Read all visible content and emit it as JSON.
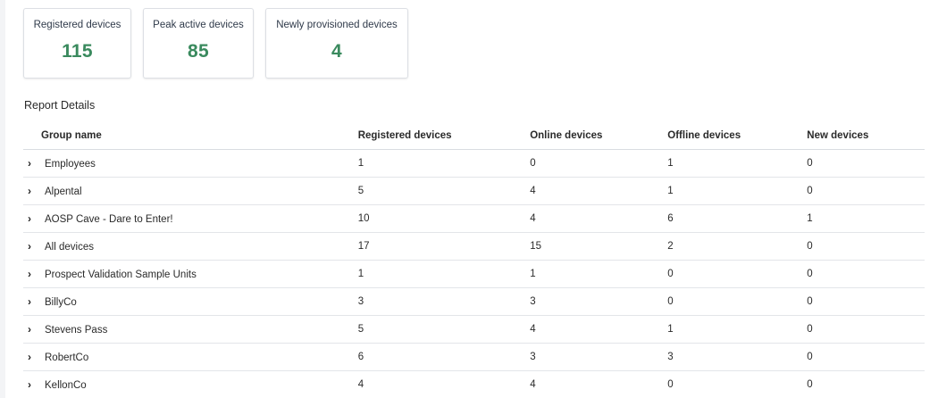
{
  "summary_cards": [
    {
      "label": "Registered devices",
      "value": "115"
    },
    {
      "label": "Peak active devices",
      "value": "85"
    },
    {
      "label": "Newly provisioned devices",
      "value": "4"
    }
  ],
  "report": {
    "title": "Report Details",
    "columns": [
      "Group name",
      "Registered devices",
      "Online devices",
      "Offline devices",
      "New devices"
    ],
    "rows": [
      {
        "name": "Employees",
        "registered": "1",
        "online": "0",
        "offline": "1",
        "new": "0"
      },
      {
        "name": "Alpental",
        "registered": "5",
        "online": "4",
        "offline": "1",
        "new": "0"
      },
      {
        "name": "AOSP Cave - Dare to Enter!",
        "registered": "10",
        "online": "4",
        "offline": "6",
        "new": "1"
      },
      {
        "name": "All devices",
        "registered": "17",
        "online": "15",
        "offline": "2",
        "new": "0"
      },
      {
        "name": "Prospect Validation Sample Units",
        "registered": "1",
        "online": "1",
        "offline": "0",
        "new": "0"
      },
      {
        "name": "BillyCo",
        "registered": "3",
        "online": "3",
        "offline": "0",
        "new": "0"
      },
      {
        "name": "Stevens Pass",
        "registered": "5",
        "online": "4",
        "offline": "1",
        "new": "0"
      },
      {
        "name": "RobertCo",
        "registered": "6",
        "online": "3",
        "offline": "3",
        "new": "0"
      },
      {
        "name": "KellonCo",
        "registered": "4",
        "online": "4",
        "offline": "0",
        "new": "0"
      }
    ]
  },
  "colors": {
    "card_value": "#3a8a5e",
    "card_border": "#dcdfe4",
    "row_divider": "#e3e5e9"
  },
  "icons": {
    "expand": "chevron-right-icon"
  }
}
